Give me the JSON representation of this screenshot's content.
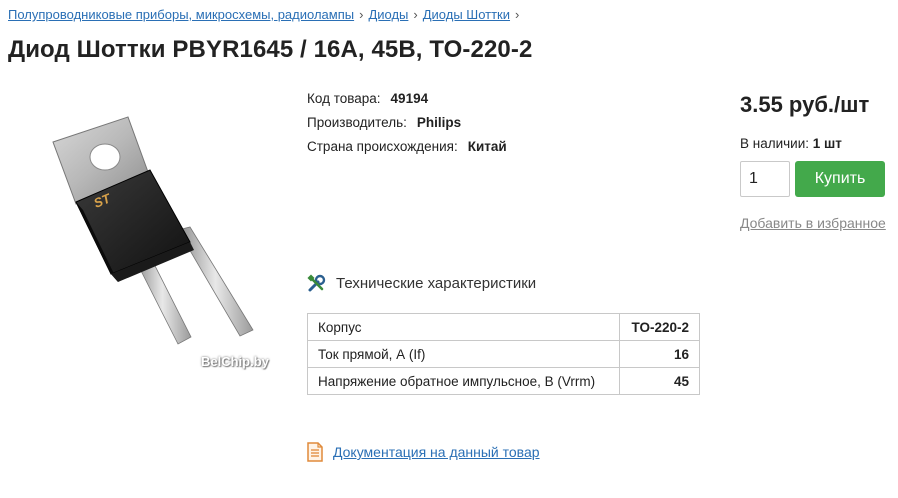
{
  "breadcrumb": {
    "items": [
      "Полупроводниковые приборы, микросхемы, радиолампы",
      "Диоды",
      "Диоды Шоттки"
    ],
    "separator": "›"
  },
  "product": {
    "title": "Диод Шоттки PBYR1645 / 16А, 45В, TO-220-2",
    "photo_watermark": "BelChip.by",
    "photo_logo_text": "ST",
    "code_label": "Код товара:",
    "code_value": "49194",
    "manufacturer_label": "Производитель:",
    "manufacturer_value": "Philips",
    "country_label": "Страна происхождения:",
    "country_value": "Китай"
  },
  "buy": {
    "price": "3.55 руб./шт",
    "stock_label": "В наличии:",
    "stock_value": "1 шт",
    "quantity": "1",
    "buy_label": "Купить",
    "favorite_label": "Добавить в избранное",
    "buy_color": "#43a94b"
  },
  "specs": {
    "title": "Технические характеристики",
    "icon": "tools-icon",
    "rows": [
      {
        "name": "Корпус",
        "value": "TO-220-2"
      },
      {
        "name": "Ток прямой, А (If)",
        "value": "16"
      },
      {
        "name": "Напряжение обратное импульсное, В (Vrrm)",
        "value": "45"
      }
    ]
  },
  "documentation": {
    "label": "Документация на данный товар",
    "icon": "document-icon"
  },
  "colors": {
    "link": "#2a6fb5",
    "accent_orange": "#e08a3a"
  }
}
